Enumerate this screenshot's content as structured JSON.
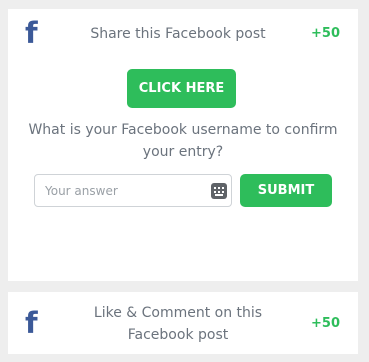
{
  "tasks": [
    {
      "icon": "facebook-icon",
      "title": "Share this Facebook post",
      "points": "+50",
      "action_button": "CLICK HERE",
      "question": "What is your Facebook username to confirm your entry?",
      "answer_placeholder": "Your answer",
      "submit_label": "SUBMIT"
    },
    {
      "icon": "facebook-icon",
      "title": "Like & Comment on this Facebook post",
      "points": "+50"
    }
  ],
  "colors": {
    "accent": "#2ebd5b",
    "facebook": "#3b5998",
    "text": "#6b737d",
    "background": "#eeeeee"
  }
}
